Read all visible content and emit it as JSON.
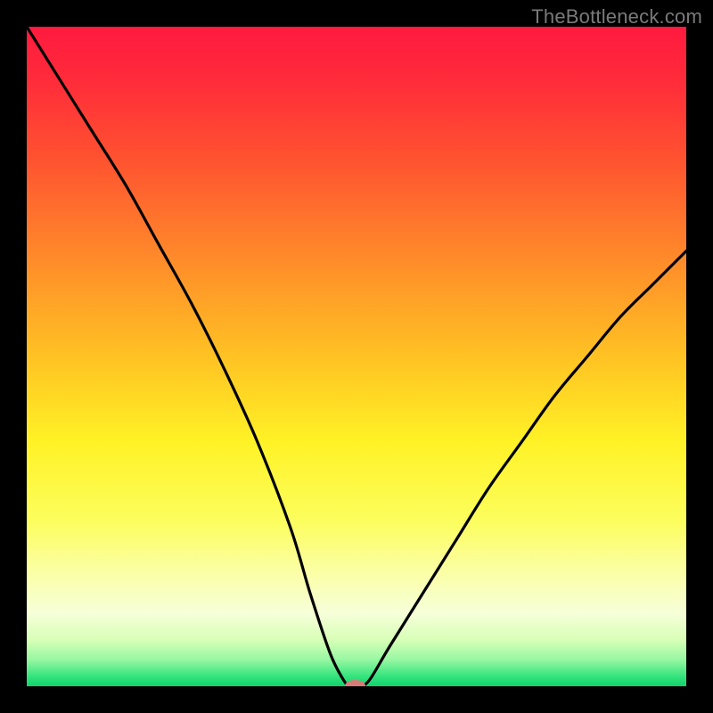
{
  "watermark": "TheBottleneck.com",
  "chart_data": {
    "type": "line",
    "title": "",
    "xlabel": "",
    "ylabel": "",
    "xlim": [
      0,
      100
    ],
    "ylim": [
      0,
      100
    ],
    "grid": false,
    "legend": false,
    "gradient_stops": [
      {
        "offset": 0.0,
        "color": "#ff1a3f"
      },
      {
        "offset": 0.08,
        "color": "#ff2b3a"
      },
      {
        "offset": 0.2,
        "color": "#ff5230"
      },
      {
        "offset": 0.35,
        "color": "#ff8a2a"
      },
      {
        "offset": 0.5,
        "color": "#ffc223"
      },
      {
        "offset": 0.63,
        "color": "#fff226"
      },
      {
        "offset": 0.75,
        "color": "#fcfe5e"
      },
      {
        "offset": 0.83,
        "color": "#fbffa8"
      },
      {
        "offset": 0.89,
        "color": "#f6ffd9"
      },
      {
        "offset": 0.93,
        "color": "#d7ffb6"
      },
      {
        "offset": 0.96,
        "color": "#96f7a2"
      },
      {
        "offset": 0.985,
        "color": "#35e47e"
      },
      {
        "offset": 1.0,
        "color": "#0fd36a"
      }
    ],
    "series": [
      {
        "name": "bottleneck-curve",
        "x": [
          0,
          5,
          10,
          15,
          20,
          25,
          30,
          35,
          40,
          43,
          46,
          48,
          49,
          50.5,
          52,
          55,
          60,
          65,
          70,
          75,
          80,
          85,
          90,
          95,
          100
        ],
        "y": [
          100,
          92,
          84,
          76,
          67,
          58,
          48,
          37,
          24,
          14,
          5,
          1,
          0,
          0,
          1,
          6,
          14,
          22,
          30,
          37,
          44,
          50,
          56,
          61,
          66
        ]
      }
    ],
    "marker": {
      "x": 49.8,
      "y": 0,
      "rx": 1.6,
      "ry": 0.9,
      "color": "#d87a77"
    }
  }
}
